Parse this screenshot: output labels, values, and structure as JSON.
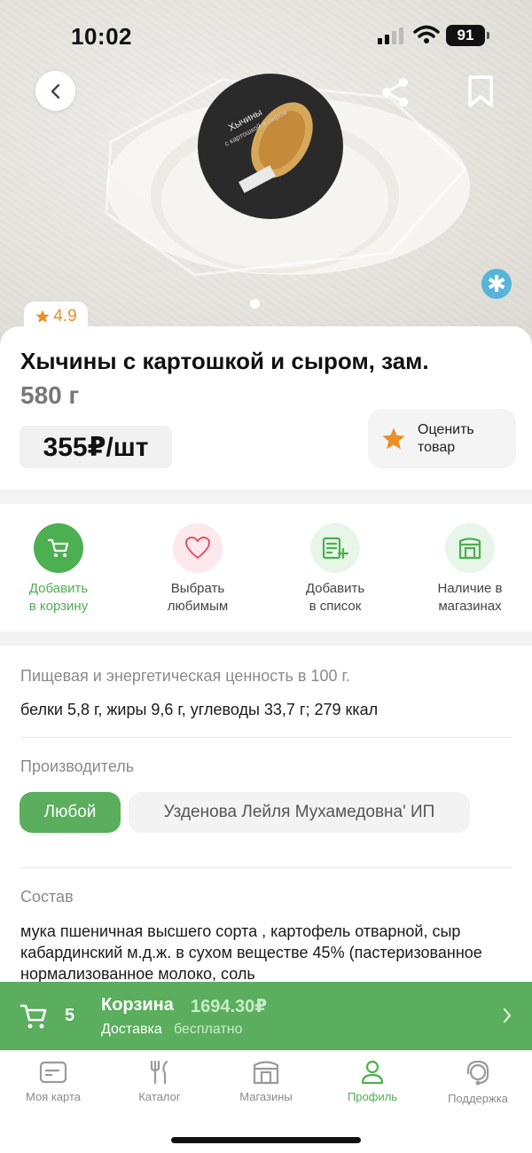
{
  "status": {
    "time": "10:02",
    "battery": "91"
  },
  "hero": {
    "rating": "4.9",
    "pack_label_1": "Хычины",
    "pack_label_2": "с картошкой и сыром"
  },
  "product": {
    "title": "Хычины с картошкой и сыром, зам.",
    "weight": "580 г",
    "price": "355₽/шт",
    "rate_button": "Оценить\nтовар"
  },
  "actions": [
    {
      "label": "Добавить\nв корзину",
      "icon": "cart-icon",
      "color": "#4caf50"
    },
    {
      "label": "Выбрать\nлюбимым",
      "icon": "heart-icon",
      "color": "#fde9ec"
    },
    {
      "label": "Добавить\nв список",
      "icon": "add-list-icon",
      "color": "#e8f5e9"
    },
    {
      "label": "Наличие в\nмагазинах",
      "icon": "store-icon",
      "color": "#e8f5e9"
    }
  ],
  "nutrition": {
    "label": "Пищевая и энергетическая ценность в 100 г.",
    "value": "белки 5,8 г, жиры 9,6 г, углеводы 33,7 г; 279 ккал"
  },
  "manufacturer": {
    "label": "Производитель",
    "chips": [
      "Любой",
      "Узденова Лейля Мухамедовна' ИП"
    ]
  },
  "composition": {
    "label": "Состав",
    "text": "мука пшеничная высшего сорта , картофель отварной, сыр кабардинский м.д.ж. в сухом веществе 45% (пастеризованное нормализованное молоко, соль"
  },
  "cart": {
    "count": "5",
    "title": "Корзина",
    "sum": "1694.30₽",
    "delivery_label": "Доставка",
    "delivery_value": "бесплатно"
  },
  "tabs": [
    {
      "label": "Моя карта",
      "icon": "card-icon",
      "active": false
    },
    {
      "label": "Каталог",
      "icon": "catalog-icon",
      "active": false
    },
    {
      "label": "Магазины",
      "icon": "stores-icon",
      "active": false
    },
    {
      "label": "Профиль",
      "icon": "profile-icon",
      "active": true
    },
    {
      "label": "Поддержка",
      "icon": "support-icon",
      "active": false
    }
  ],
  "colors": {
    "accent": "#5aae5d",
    "star": "#e8902a",
    "snow": "#56b4d9"
  }
}
